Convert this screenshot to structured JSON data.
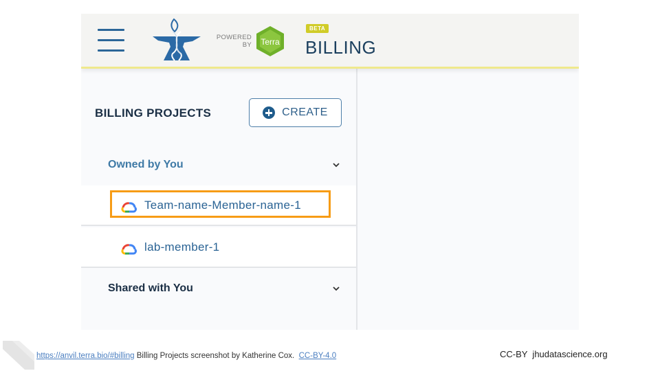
{
  "header": {
    "menu_icon": "hamburger-menu-icon",
    "logo_icon": "anvil-dna-logo-icon",
    "powered_line1": "POWERED",
    "powered_line2": "BY",
    "terra_label": "Terra",
    "beta_badge": "BETA",
    "page_title": "BILLING"
  },
  "sidebar": {
    "title": "BILLING PROJECTS",
    "create_button": {
      "label": "CREATE",
      "icon": "plus-circle-icon"
    },
    "sections": [
      {
        "label": "Owned by You",
        "icon": "chevron-down-icon",
        "projects": [
          {
            "name": "Team-name-Member-name-1",
            "icon": "google-cloud-icon",
            "highlighted": true
          },
          {
            "name": "lab-member-1",
            "icon": "google-cloud-icon",
            "highlighted": false
          }
        ]
      },
      {
        "label": "Shared with You",
        "icon": "chevron-down-icon",
        "projects": []
      }
    ]
  },
  "colors": {
    "highlight_border": "#f79c16",
    "primary_blue": "#2a6394",
    "header_underline": "#efe98c",
    "beta_badge": "#d0cc28",
    "terra_green": "#7ab929"
  },
  "footer": {
    "link_url_text": "https://anvil.terra.bio/#billing",
    "credit_text": " Billing Projects screenshot by Katherine Cox.  ",
    "license_link": "CC-BY-4.0",
    "right_text": "CC-BY  jhudatascience.org"
  }
}
